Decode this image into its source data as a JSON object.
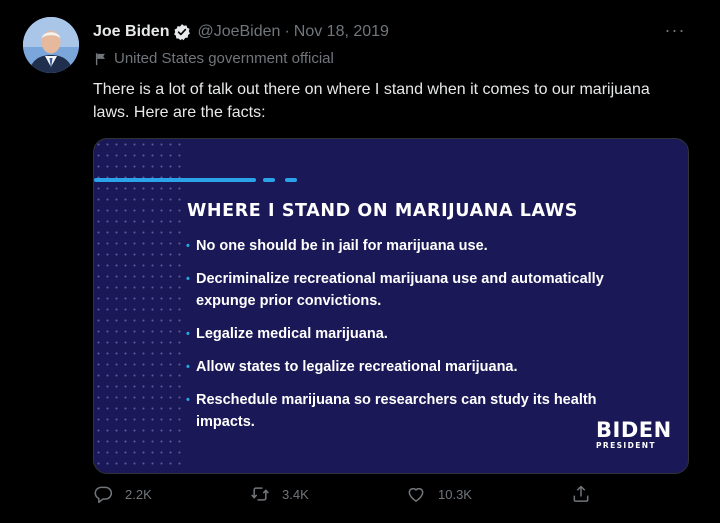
{
  "tweet": {
    "author_name": "Joe Biden",
    "handle": "@JoeBiden",
    "separator": "·",
    "date": "Nov 18, 2019",
    "label": "United States government official",
    "text": "There is a lot of talk out there on where I stand when it comes to our marijuana laws. Here are the facts:",
    "more_label": "···",
    "icons": {
      "verified": "verified-badge-icon",
      "label": "flag-icon",
      "more": "more-options-icon"
    }
  },
  "card": {
    "title": "WHERE I STAND ON MARIJUANA LAWS",
    "bullets": [
      "No one should be in jail for marijuana use.",
      "Decriminalize recreational marijuana use and automatically expunge prior convictions.",
      "Legalize medical marijuana.",
      "Allow states to legalize recreational marijuana.",
      "Reschedule marijuana so researchers can study its health impacts."
    ],
    "logo_word": "BIDEN",
    "logo_sub": "PRESIDENT",
    "colors": {
      "background": "#1a1856",
      "accent": "#2aa3e8",
      "text": "#ffffff"
    }
  },
  "actions": {
    "reply": {
      "icon": "reply-icon",
      "count": "2.2K"
    },
    "retweet": {
      "icon": "retweet-icon",
      "count": "3.4K"
    },
    "like": {
      "icon": "heart-icon",
      "count": "10.3K"
    },
    "share": {
      "icon": "share-icon"
    }
  },
  "colors": {
    "page_background": "#000000",
    "muted_text": "#71767b",
    "primary_text": "#e7e9ea",
    "verified_badge": "#e7e9ea"
  }
}
